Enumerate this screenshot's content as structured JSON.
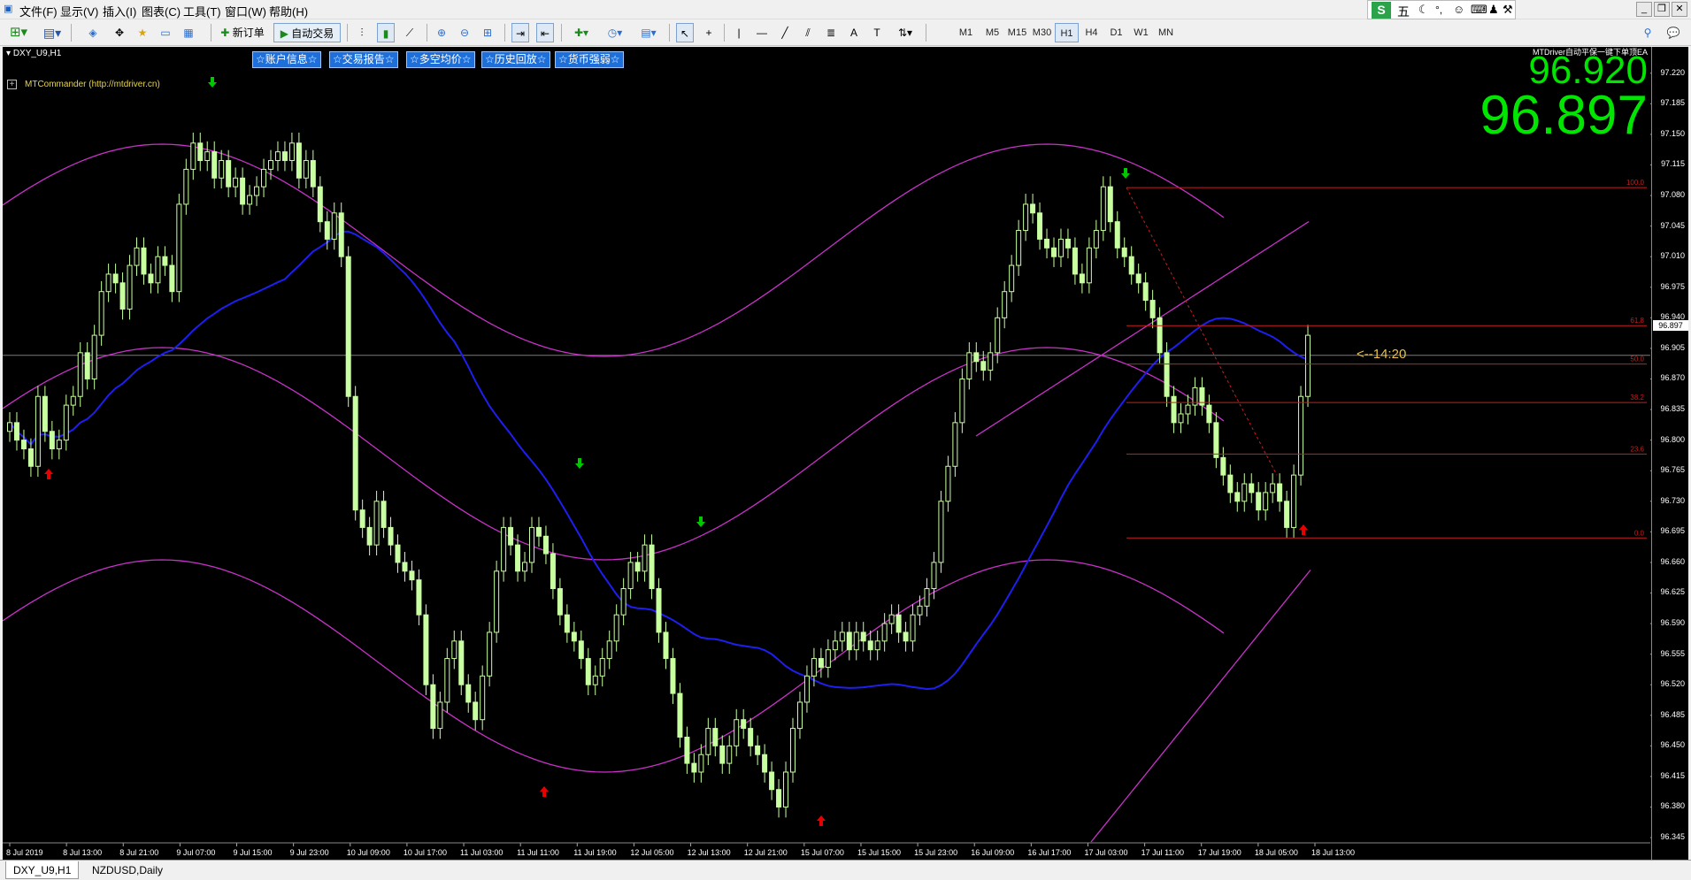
{
  "menu": {
    "items": [
      "文件(F)",
      "显示(V)",
      "插入(I)",
      "图表(C)",
      "工具(T)",
      "窗口(W)",
      "帮助(H)"
    ],
    "ime_label": "五"
  },
  "toolbar": {
    "new_order": "新订单",
    "auto_trade": "自动交易",
    "timeframes": [
      "M1",
      "M5",
      "M15",
      "M30",
      "H1",
      "H4",
      "D1",
      "W1",
      "MN"
    ],
    "active_timeframe": "H1"
  },
  "chart": {
    "symbol_label": "DXY_U9,H1",
    "commander_label": "MTCommander (http://mtdriver.cn)",
    "ea_label": "MTDriver自动平保一键下单顶EA",
    "ea_buttons": [
      "☆账户信息☆",
      "☆交易报告☆",
      "☆多空均价☆",
      "☆历史回放☆",
      "☆货币强弱☆"
    ],
    "ask_price": "96.920",
    "bid_price": "96.897",
    "countdown": "<--14:20",
    "current_price_label": "96.897",
    "fib_levels": [
      {
        "label": "100.0",
        "price": 97.089
      },
      {
        "label": "61.8",
        "price": 96.931
      },
      {
        "label": "50.0",
        "price": 96.887
      },
      {
        "label": "38.2",
        "price": 96.843
      },
      {
        "label": "23.6",
        "price": 96.784
      },
      {
        "label": "0.0",
        "price": 96.688
      }
    ],
    "colors": {
      "candle": "#c8ffa0",
      "ma_line": "#1e1ef0",
      "bands": "#c832c8",
      "fib": "#c81e1e",
      "price_big": "#00e600",
      "arrow_down": "#00c800",
      "arrow_up": "#e60000",
      "countdown": "#e8c04a"
    }
  },
  "chart_data": {
    "type": "candlestick",
    "symbol": "DXY_U9",
    "timeframe": "H1",
    "ylim": [
      96.34,
      97.24
    ],
    "y_ticks": [
      "97.220",
      "97.185",
      "97.150",
      "97.115",
      "97.080",
      "97.045",
      "97.010",
      "96.975",
      "96.940",
      "96.905",
      "96.870",
      "96.835",
      "96.800",
      "96.765",
      "96.730",
      "96.695",
      "96.660",
      "96.625",
      "96.590",
      "96.555",
      "96.520",
      "96.485",
      "96.450",
      "96.415",
      "96.380",
      "96.345"
    ],
    "x_ticks": [
      "8 Jul 2019",
      "8 Jul 13:00",
      "8 Jul 21:00",
      "9 Jul 07:00",
      "9 Jul 15:00",
      "9 Jul 23:00",
      "10 Jul 09:00",
      "10 Jul 17:00",
      "11 Jul 03:00",
      "11 Jul 11:00",
      "11 Jul 19:00",
      "12 Jul 05:00",
      "12 Jul 13:00",
      "12 Jul 21:00",
      "15 Jul 07:00",
      "15 Jul 15:00",
      "15 Jul 23:00",
      "16 Jul 09:00",
      "16 Jul 17:00",
      "17 Jul 03:00",
      "17 Jul 11:00",
      "17 Jul 19:00",
      "18 Jul 05:00",
      "18 Jul 13:00"
    ],
    "last_close": 96.897,
    "closes": [
      96.82,
      96.8,
      96.79,
      96.77,
      96.85,
      96.81,
      96.79,
      96.8,
      96.84,
      96.85,
      96.9,
      96.87,
      96.92,
      96.97,
      96.99,
      96.98,
      96.95,
      97.0,
      97.02,
      96.99,
      96.98,
      97.01,
      97.0,
      96.97,
      97.07,
      97.11,
      97.14,
      97.12,
      97.13,
      97.1,
      97.12,
      97.09,
      97.1,
      97.07,
      97.08,
      97.09,
      97.11,
      97.12,
      97.13,
      97.12,
      97.14,
      97.1,
      97.12,
      97.09,
      97.05,
      97.03,
      97.06,
      97.01,
      96.85,
      96.72,
      96.7,
      96.68,
      96.73,
      96.7,
      96.68,
      96.66,
      96.65,
      96.64,
      96.6,
      96.52,
      96.47,
      96.5,
      96.55,
      96.57,
      96.52,
      96.5,
      96.48,
      96.53,
      96.58,
      96.65,
      96.7,
      96.68,
      96.65,
      96.66,
      96.7,
      96.69,
      96.67,
      96.63,
      96.6,
      96.58,
      96.57,
      96.55,
      96.52,
      96.53,
      96.55,
      96.57,
      96.6,
      96.63,
      96.66,
      96.65,
      96.68,
      96.63,
      96.58,
      96.55,
      96.51,
      96.46,
      96.43,
      96.42,
      96.44,
      96.47,
      96.45,
      96.43,
      96.45,
      96.48,
      96.47,
      96.45,
      96.44,
      96.42,
      96.4,
      96.38,
      96.42,
      96.47,
      96.5,
      96.53,
      96.55,
      96.54,
      96.56,
      96.57,
      96.58,
      96.56,
      96.58,
      96.57,
      96.56,
      96.57,
      96.59,
      96.6,
      96.58,
      96.57,
      96.6,
      96.61,
      96.63,
      96.66,
      96.73,
      96.77,
      96.82,
      96.87,
      96.9,
      96.89,
      96.88,
      96.9,
      96.94,
      96.97,
      97.0,
      97.04,
      97.07,
      97.06,
      97.03,
      97.02,
      97.01,
      97.03,
      97.02,
      96.99,
      96.98,
      97.02,
      97.04,
      97.09,
      97.05,
      97.02,
      97.01,
      96.99,
      96.98,
      96.96,
      96.94,
      96.9,
      96.85,
      96.82,
      96.83,
      96.84,
      96.86,
      96.84,
      96.82,
      96.78,
      96.76,
      96.74,
      96.73,
      96.75,
      96.74,
      96.72,
      96.74,
      96.75,
      96.73,
      96.7,
      96.76,
      96.85,
      96.92
    ]
  }
}
